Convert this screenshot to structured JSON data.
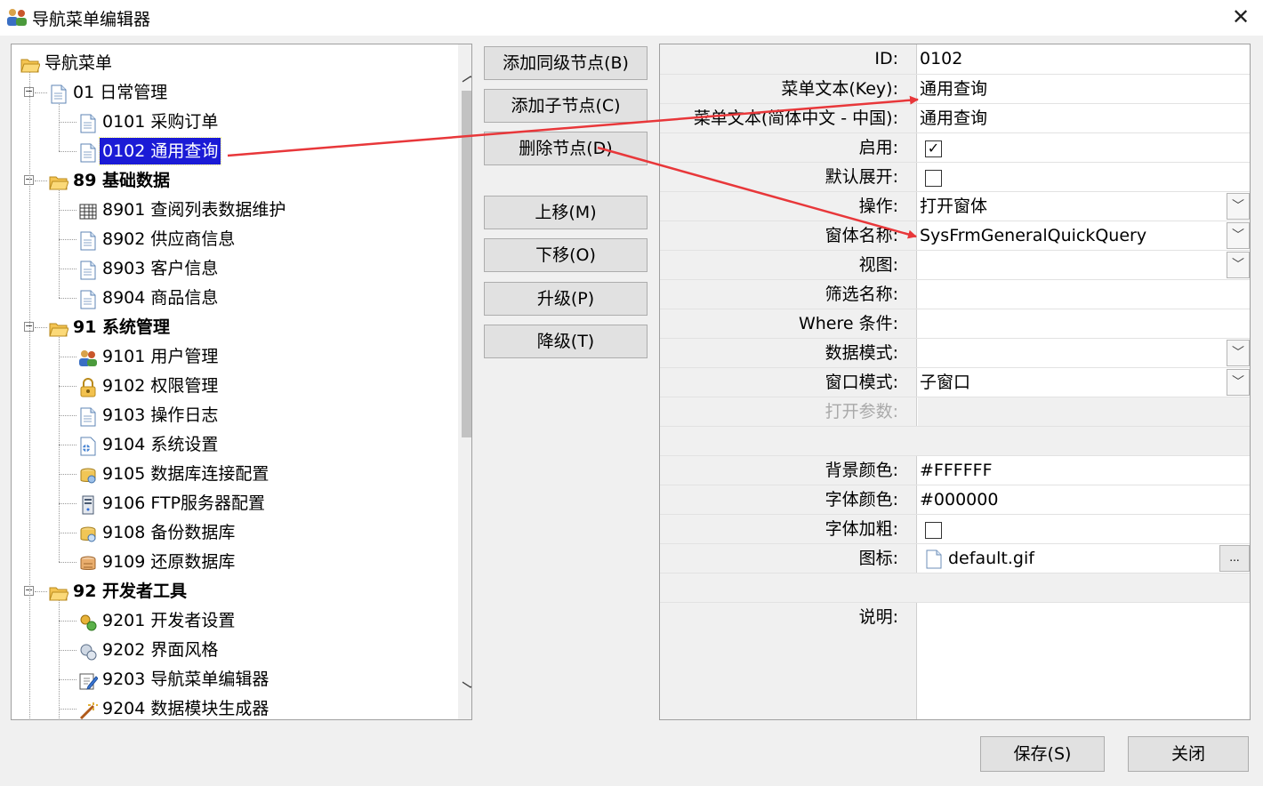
{
  "window": {
    "title": "导航菜单编辑器",
    "close_glyph": "✕"
  },
  "tree": {
    "root": {
      "label": "导航菜单",
      "icon": "folder-open-icon"
    },
    "nodes": [
      {
        "label": "01 日常管理",
        "icon": "document-icon",
        "bold": false
      },
      {
        "label": "0101 采购订单",
        "icon": "document-icon"
      },
      {
        "label": "0102 通用查询",
        "icon": "document-icon",
        "selected": true
      },
      {
        "label": "89 基础数据",
        "icon": "folder-open-icon",
        "bold": true
      },
      {
        "label": "8901 查阅列表数据维护",
        "icon": "grid-icon"
      },
      {
        "label": "8902 供应商信息",
        "icon": "document-icon"
      },
      {
        "label": "8903 客户信息",
        "icon": "document-icon"
      },
      {
        "label": "8904 商品信息",
        "icon": "document-icon"
      },
      {
        "label": "91 系统管理",
        "icon": "folder-open-icon",
        "bold": true
      },
      {
        "label": "9101 用户管理",
        "icon": "users-icon"
      },
      {
        "label": "9102 权限管理",
        "icon": "lock-icon"
      },
      {
        "label": "9103 操作日志",
        "icon": "document-icon"
      },
      {
        "label": "9104 系统设置",
        "icon": "settings-doc-icon"
      },
      {
        "label": "9105 数据库连接配置",
        "icon": "database-config-icon"
      },
      {
        "label": "9106 FTP服务器配置",
        "icon": "server-icon"
      },
      {
        "label": "9108 备份数据库",
        "icon": "database-backup-icon"
      },
      {
        "label": "9109 还原数据库",
        "icon": "database-restore-icon"
      },
      {
        "label": "92 开发者工具",
        "icon": "folder-open-icon",
        "bold": true
      },
      {
        "label": "9201 开发者设置",
        "icon": "developer-settings-icon"
      },
      {
        "label": "9202 界面风格",
        "icon": "style-icon"
      },
      {
        "label": "9203 导航菜单编辑器",
        "icon": "edit-icon"
      },
      {
        "label": "9204 数据模块生成器",
        "icon": "wand-icon"
      }
    ]
  },
  "buttons": {
    "add_sibling": "添加同级节点(B)",
    "add_child": "添加子节点(C)",
    "delete_node": "删除节点(D)",
    "move_up": "上移(M)",
    "move_down": "下移(O)",
    "promote": "升级(P)",
    "demote": "降级(T)",
    "save": "保存(S)",
    "close": "关闭"
  },
  "props": {
    "id": {
      "label": "ID:",
      "value": "0102"
    },
    "menu_text_key": {
      "label": "菜单文本(Key):",
      "value": "通用查询"
    },
    "menu_text_zh": {
      "label": "菜单文本(简体中文 - 中国):",
      "value": "通用查询"
    },
    "enabled": {
      "label": "启用:",
      "checked": true
    },
    "default_expand": {
      "label": "默认展开:",
      "checked": false
    },
    "operation": {
      "label": "操作:",
      "value": "打开窗体"
    },
    "form_name": {
      "label": "窗体名称:",
      "value": "SysFrmGeneralQuickQuery"
    },
    "view": {
      "label": "视图:",
      "value": ""
    },
    "filter_name": {
      "label": "筛选名称:",
      "value": ""
    },
    "where": {
      "label": "Where 条件:",
      "value": ""
    },
    "data_mode": {
      "label": "数据模式:",
      "value": ""
    },
    "window_mode": {
      "label": "窗口模式:",
      "value": "子窗口"
    },
    "open_params": {
      "label": "打开参数:",
      "value": ""
    },
    "bg_color": {
      "label": "背景颜色:",
      "value": "#FFFFFF"
    },
    "font_color": {
      "label": "字体颜色:",
      "value": "#000000"
    },
    "font_bold": {
      "label": "字体加粗:",
      "checked": false
    },
    "icon": {
      "label": "图标:",
      "value": "default.gif"
    },
    "description": {
      "label": "说明:",
      "value": ""
    }
  },
  "colors": {
    "selection": "#1b1bd6",
    "annotation_arrow": "#e8373a"
  }
}
